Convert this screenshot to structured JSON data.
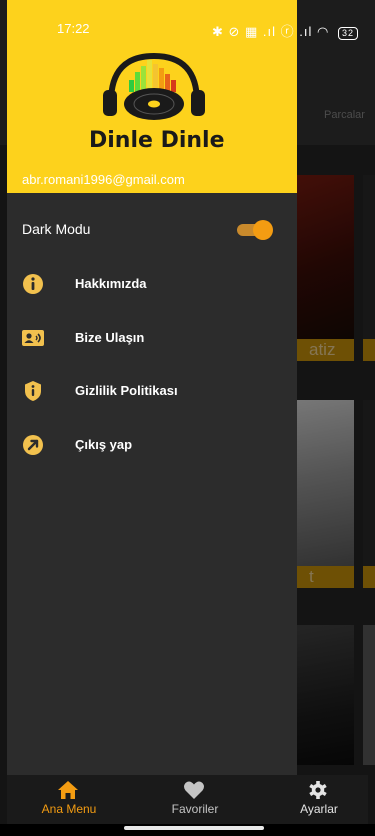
{
  "status_bar": {
    "time": "17:22",
    "right_icons": "✱ ⊘ ▦ .ıl ⓡ .ıl ◠",
    "battery": "32"
  },
  "drawer": {
    "brand": "Dinle Dinle",
    "email": "abr.romani1996@gmail.com",
    "dark_mode_label": "Dark Modu",
    "dark_mode_on": true,
    "items": [
      {
        "label": "Hakkımızda",
        "icon": "info-icon"
      },
      {
        "label": "Bize Ulaşın",
        "icon": "contact-card-icon"
      },
      {
        "label": "Gizlilik Politikası",
        "icon": "shield-icon"
      },
      {
        "label": "Çıkış yap",
        "icon": "exit-arrow-icon"
      }
    ]
  },
  "background": {
    "tab_label": "Parcalar",
    "card_captions": [
      "atiz",
      "t"
    ]
  },
  "bottom_nav": {
    "items": [
      {
        "label": "Ana Menu",
        "icon": "home-icon",
        "active": true
      },
      {
        "label": "Favoriler",
        "icon": "heart-icon",
        "active": false
      },
      {
        "label": "Ayarlar",
        "icon": "gear-icon",
        "active": false
      }
    ]
  },
  "colors": {
    "accent": "#f39c12",
    "header_yellow": "#fdd21c",
    "drawer_bg": "#2c2c2c",
    "icon_yellow": "#f2c14e"
  }
}
